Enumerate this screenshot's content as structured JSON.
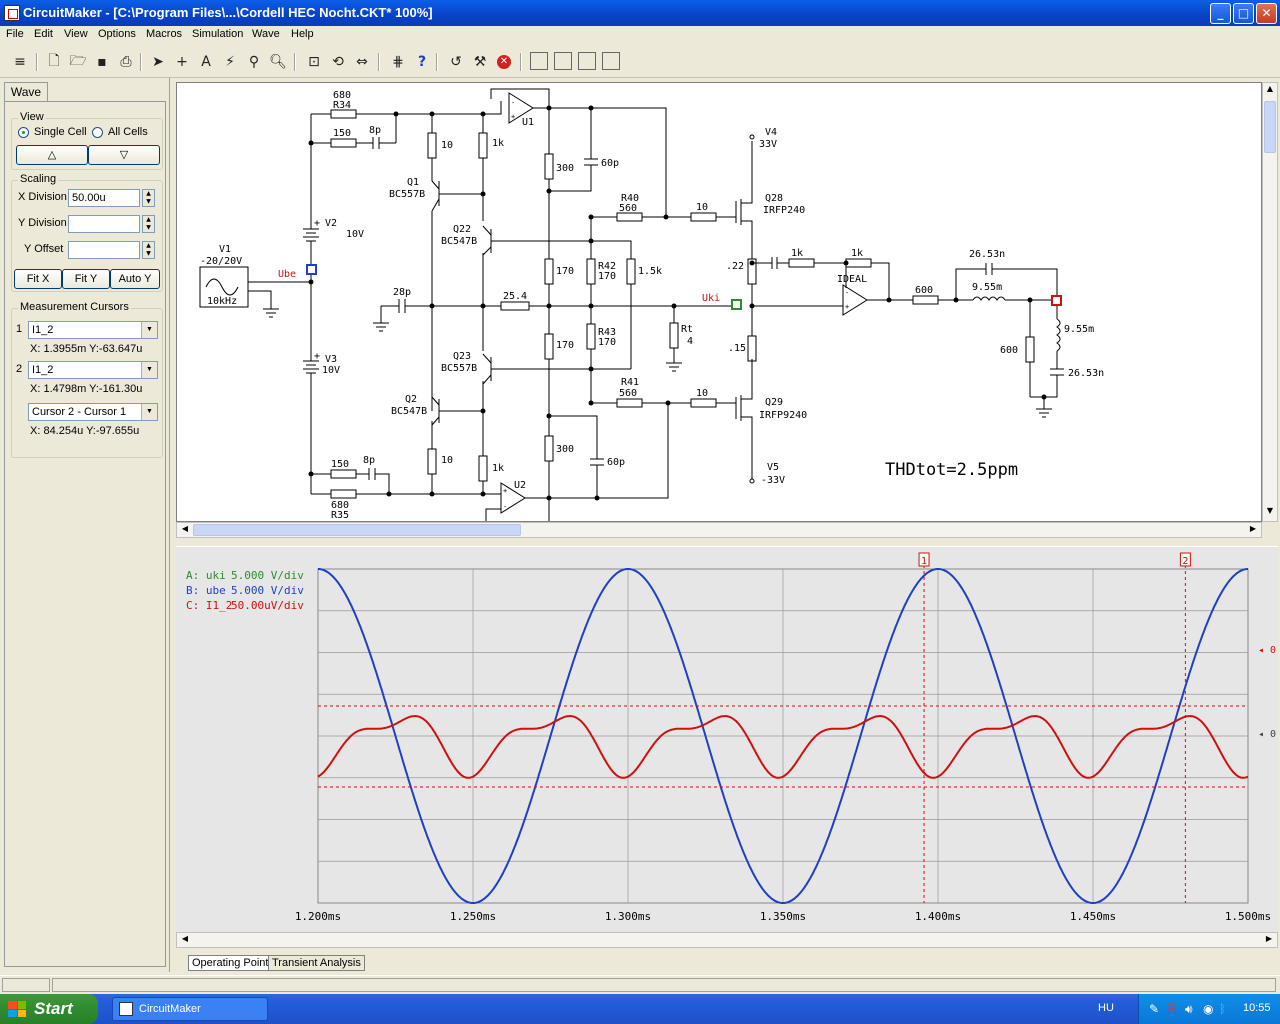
{
  "window": {
    "title": "CircuitMaker - [C:\\Program Files\\...\\Cordell HEC Nocht.CKT* 100%]",
    "minimize": "_",
    "maximize": "□",
    "close": "✕"
  },
  "menu": [
    "File",
    "Edit",
    "View",
    "Options",
    "Macros",
    "Simulation",
    "Wave",
    "Help"
  ],
  "toolbar_icons": [
    "arrange-icon",
    "new-icon",
    "open-icon",
    "save-icon",
    "print-icon",
    "pointer-icon",
    "wire-icon",
    "text-icon",
    "probe-icon",
    "zoom-icon",
    "magnify-icon",
    "fit-icon",
    "rotate-icon",
    "mirror-icon",
    "digital-icon",
    "help-icon",
    "undo-icon",
    "tool-icon",
    "stop-icon",
    "cell1-icon",
    "cell2-icon",
    "cell3-icon",
    "cell4-icon"
  ],
  "panel": {
    "tab": "Wave",
    "view": {
      "title": "View",
      "single_cell": "Single Cell",
      "all_cells": "All Cells",
      "up": "△",
      "down": "▽"
    },
    "scaling": {
      "title": "Scaling",
      "x_division_label": "X Division",
      "x_division_value": "50.00u",
      "y_division_label": "Y Division",
      "y_division_value": "",
      "y_offset_label": "Y Offset",
      "y_offset_value": "",
      "fit_x": "Fit X",
      "fit_y": "Fit Y",
      "auto_y": "Auto Y"
    },
    "cursors": {
      "title": "Measurement Cursors",
      "c1_index": "1",
      "c1_signal": "I1_2",
      "c1_readout": "X: 1.3955m  Y:-63.647u",
      "c2_index": "2",
      "c2_signal": "I1_2",
      "c2_readout": "X: 1.4798m  Y:-161.30u",
      "diff_mode": "Cursor 2 - Cursor 1",
      "diff_readout": "X: 84.254u  Y:-97.655u"
    }
  },
  "schematic": {
    "labels": {
      "r34_val": "680",
      "r34": "R34",
      "r150a": "150",
      "c8pa": "8p",
      "r10a": "10",
      "r1ka": "1k",
      "u1": "U1",
      "q1": "Q1",
      "q1t": "BC557B",
      "q22": "Q22",
      "q22t": "BC547B",
      "v2p": "+",
      "v2": "V2",
      "v2v": "10V",
      "v1": "V1",
      "v1v": "-20/20V",
      "v1f": "10kHz",
      "ube": "Ube",
      "c28p": "28p",
      "r254": "25.4",
      "r300a": "300",
      "c60pa": "60p",
      "r40": "R40",
      "r560a": "560",
      "r10g1": "10",
      "q28": "Q28",
      "q28t": "IRFP240",
      "v4": "V4",
      "v4v": "33V",
      "r170a": "170",
      "r42": "R42",
      "r170b": "170",
      "r15k": "1.5k",
      "r22": ".22",
      "r1kb": "1k",
      "r1kc": "1k",
      "ideal": "IDEAL",
      "c2653a": "26.53n",
      "l955a": "9.55m",
      "r600a": "600",
      "uki": "Uki",
      "r43": "R43",
      "r170c": "170",
      "r170d": "170",
      "rt": "Rt",
      "rt4": "4",
      "r15": ".15",
      "r600b": "600",
      "l955b": "9.55m",
      "c2653b": "26.53n",
      "q23": "Q23",
      "q23t": "BC557B",
      "v3p": "+",
      "v3": "V3",
      "v3v": "10V",
      "q2": "Q2",
      "q2t": "BC547B",
      "r41": "R41",
      "r560b": "560",
      "r10g2": "10",
      "q29": "Q29",
      "q29t": "IRFP9240",
      "r300b": "300",
      "c60pb": "60p",
      "r10b": "10",
      "r1kd": "1k",
      "r150b": "150",
      "c8pb": "8p",
      "r680b": "680",
      "r35": "R35",
      "u2": "U2",
      "v5": "V5",
      "v5v": "-33V",
      "thd": "THDtot=2.5ppm"
    }
  },
  "wave": {
    "legend": [
      {
        "id": "A",
        "name": "uki",
        "scale": "5.000 V/div",
        "color": "#2e8b2e"
      },
      {
        "id": "B",
        "name": "ube",
        "scale": "5.000 V/div",
        "color": "#1f3fc4"
      },
      {
        "id": "C",
        "name": "I1_2",
        "scale": "50.00uV/div",
        "color": "#d01010"
      }
    ],
    "cursor_labels": [
      "1",
      "2"
    ],
    "zero_labels": [
      "0",
      "0"
    ],
    "tab_operating": "Operating Point",
    "tab_transient": "Transient Analysis"
  },
  "chart_data": {
    "type": "line",
    "x_unit": "ms",
    "xlim": [
      1.2,
      1.5
    ],
    "x_ticks": [
      "1.200ms",
      "1.250ms",
      "1.300ms",
      "1.350ms",
      "1.400ms",
      "1.450ms",
      "1.500ms"
    ],
    "cursors": [
      1.3955,
      1.4798
    ],
    "series": [
      {
        "name": "ube",
        "color": "#1f3fc4",
        "frequency_khz": 10,
        "amplitude_divs": 4
      },
      {
        "name": "I1_2",
        "color": "#d01010",
        "frequency_khz": 20,
        "amplitude_divs": 1
      }
    ]
  },
  "taskbar": {
    "start": "Start",
    "task": "CircuitMaker",
    "lang": "HU",
    "clock": "10:55"
  }
}
